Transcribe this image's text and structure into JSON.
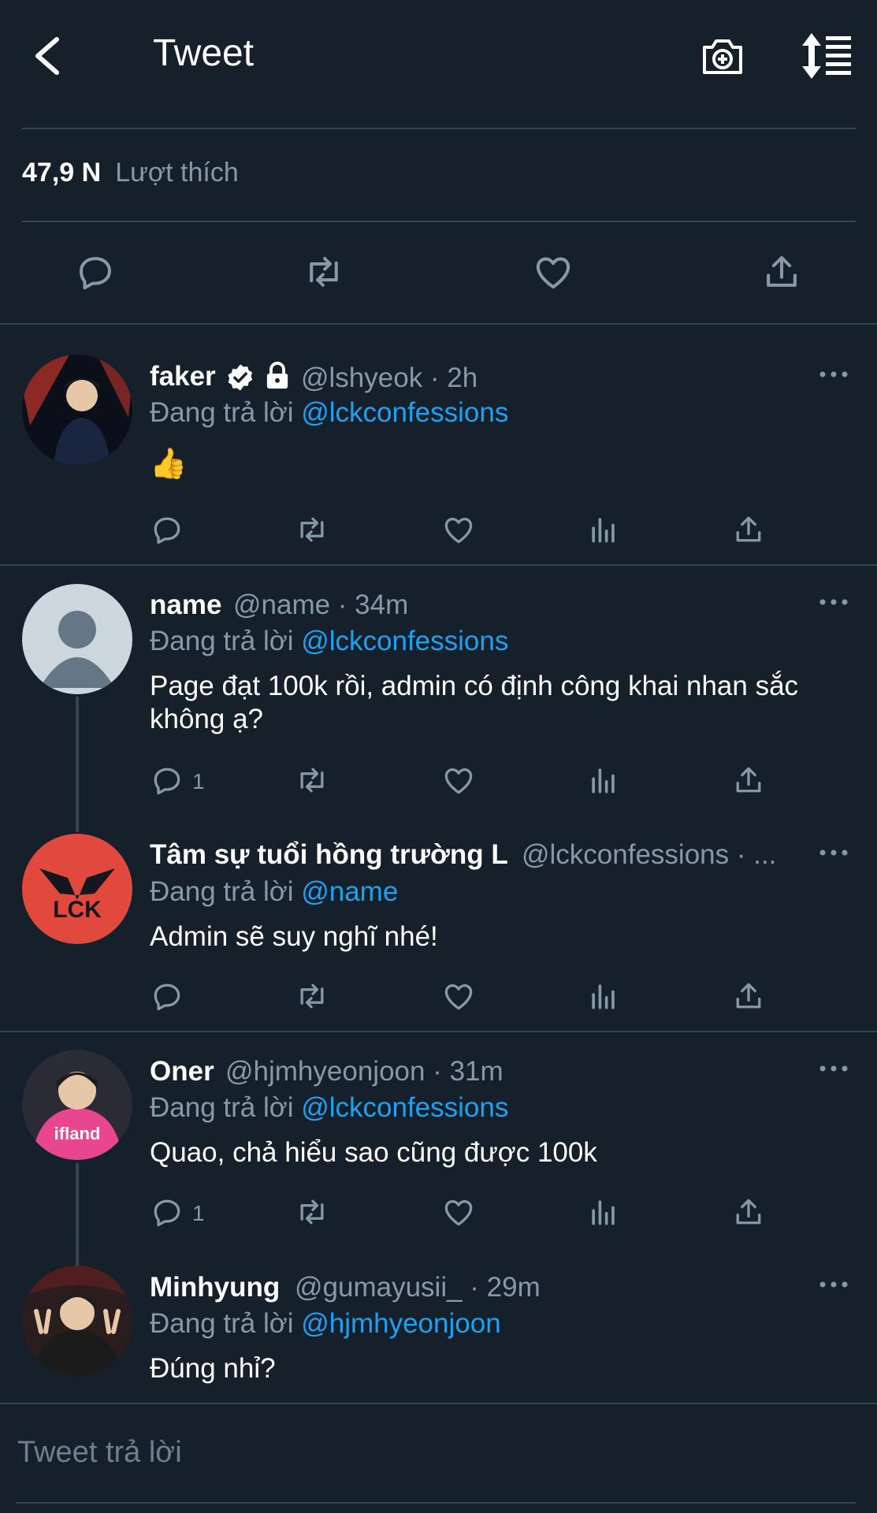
{
  "header": {
    "title": "Tweet",
    "icons": [
      "back-arrow-icon",
      "camera-plus-icon",
      "sort-list-icon"
    ]
  },
  "likes": {
    "count": "47,9 N",
    "label": "Lượt thích"
  },
  "main_actions": [
    "reply-icon",
    "retweet-icon",
    "like-icon",
    "share-icon"
  ],
  "colors": {
    "background": "#15202b",
    "divider": "#38444d",
    "muted": "#8899a6",
    "link": "#1da1f2"
  },
  "replies": [
    {
      "name": "faker",
      "verified": true,
      "locked": true,
      "meta": "@lshyeok · 2h",
      "reply_prefix": "Đang trả lời",
      "reply_to": "@lckconfessions",
      "text": "👍",
      "reply_count": ""
    },
    {
      "name": "name",
      "meta": "@name · 34m",
      "reply_prefix": "Đang trả lời",
      "reply_to": "@lckconfessions",
      "text": "Page đạt 100k rồi, admin có định công khai nhan sắc không ạ?",
      "reply_count": "1"
    },
    {
      "name": "Tâm sự tuổi hồng trường L",
      "meta": "@lckconfessions · ...",
      "reply_prefix": "Đang trả lời",
      "reply_to": "@name",
      "text": "Admin sẽ suy nghĩ nhé!",
      "reply_count": ""
    },
    {
      "name": "Oner",
      "meta": "@hjmhyeonjoon · 31m",
      "reply_prefix": "Đang trả lời",
      "reply_to": "@lckconfessions",
      "text": "Quao, chả hiểu sao cũng được 100k",
      "reply_count": "1"
    },
    {
      "name": "Minhyung",
      "meta": "@gumayusii_ · 29m",
      "reply_prefix": "Đang trả lời",
      "reply_to": "@hjmhyeonjoon",
      "text": "Đúng nhỉ?",
      "reply_count": ""
    }
  ],
  "reply_input": {
    "placeholder": "Tweet trả lời"
  }
}
